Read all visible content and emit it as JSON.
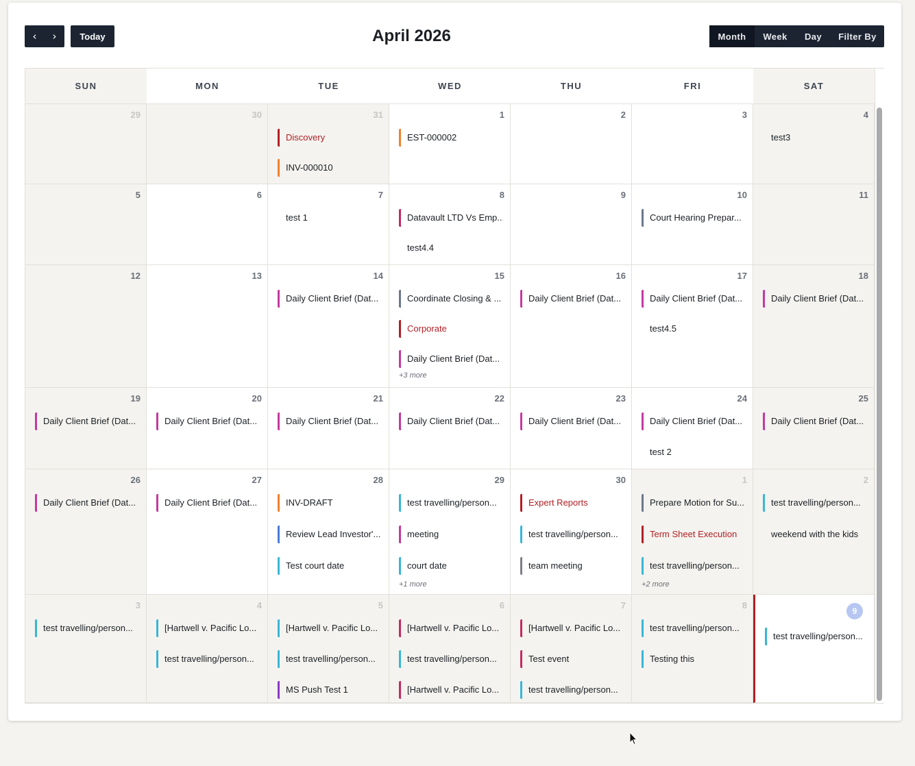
{
  "toolbar": {
    "prev_icon": "‹",
    "next_icon": "›",
    "today_label": "Today",
    "title": "April 2026",
    "views": [
      "Month",
      "Week",
      "Day",
      "Filter By"
    ],
    "active_view": "Month"
  },
  "colors": {
    "red": "#b21f24",
    "orange": "#f0812e",
    "magenta": "#c3399f",
    "crimson": "#c42a61",
    "slate": "#6b778c",
    "cyan": "#38b6d6",
    "blue": "#4a7bd8",
    "purple": "#8d37c7",
    "gray": "#7d7f86"
  },
  "days_of_week": [
    "SUN",
    "MON",
    "TUE",
    "WED",
    "THU",
    "FRI",
    "SAT"
  ],
  "weeks": [
    [
      {
        "day": "29",
        "muted": true,
        "events": []
      },
      {
        "day": "30",
        "muted": true,
        "events": []
      },
      {
        "day": "31",
        "muted": true,
        "events": [
          {
            "title": "Discovery",
            "color": "red",
            "red_text": true
          },
          {
            "title": "INV-000010",
            "color": "orange"
          }
        ]
      },
      {
        "day": "1",
        "events": [
          {
            "title": "EST-000002",
            "color": "orange"
          }
        ]
      },
      {
        "day": "2",
        "events": []
      },
      {
        "day": "3",
        "events": []
      },
      {
        "day": "4",
        "weekend": true,
        "events": [
          {
            "title": "test3",
            "color": null
          }
        ]
      }
    ],
    [
      {
        "day": "5",
        "weekend": true,
        "events": []
      },
      {
        "day": "6",
        "events": []
      },
      {
        "day": "7",
        "events": [
          {
            "title": "test 1",
            "color": null
          }
        ]
      },
      {
        "day": "8",
        "events": [
          {
            "title": "Datavault LTD Vs Emp...",
            "color": "crimson"
          },
          {
            "title": "test4.4",
            "color": null
          }
        ]
      },
      {
        "day": "9",
        "events": []
      },
      {
        "day": "10",
        "events": [
          {
            "title": "Court Hearing Prepar...",
            "color": "slate"
          }
        ]
      },
      {
        "day": "11",
        "weekend": true,
        "events": []
      }
    ],
    [
      {
        "day": "12",
        "weekend": true,
        "events": []
      },
      {
        "day": "13",
        "events": []
      },
      {
        "day": "14",
        "events": [
          {
            "title": "Daily Client Brief (Dat...",
            "color": "magenta"
          }
        ]
      },
      {
        "day": "15",
        "events": [
          {
            "title": "Coordinate Closing & ...",
            "color": "slate"
          },
          {
            "title": "Corporate",
            "color": "red",
            "red_text": true
          },
          {
            "title": "Daily Client Brief (Dat...",
            "color": "magenta"
          }
        ],
        "more": "+3 more"
      },
      {
        "day": "16",
        "events": [
          {
            "title": "Daily Client Brief (Dat...",
            "color": "magenta"
          }
        ]
      },
      {
        "day": "17",
        "events": [
          {
            "title": "Daily Client Brief (Dat...",
            "color": "magenta"
          },
          {
            "title": "test4.5",
            "color": null
          }
        ]
      },
      {
        "day": "18",
        "weekend": true,
        "events": [
          {
            "title": "Daily Client Brief (Dat...",
            "color": "magenta"
          }
        ]
      }
    ],
    [
      {
        "day": "19",
        "weekend": true,
        "events": [
          {
            "title": "Daily Client Brief (Dat...",
            "color": "magenta"
          }
        ]
      },
      {
        "day": "20",
        "events": [
          {
            "title": "Daily Client Brief (Dat...",
            "color": "magenta"
          }
        ]
      },
      {
        "day": "21",
        "events": [
          {
            "title": "Daily Client Brief (Dat...",
            "color": "magenta"
          }
        ]
      },
      {
        "day": "22",
        "events": [
          {
            "title": "Daily Client Brief (Dat...",
            "color": "magenta"
          }
        ]
      },
      {
        "day": "23",
        "events": [
          {
            "title": "Daily Client Brief (Dat...",
            "color": "magenta"
          }
        ]
      },
      {
        "day": "24",
        "events": [
          {
            "title": "Daily Client Brief (Dat...",
            "color": "magenta"
          },
          {
            "title": "test 2",
            "color": null
          }
        ]
      },
      {
        "day": "25",
        "weekend": true,
        "events": [
          {
            "title": "Daily Client Brief (Dat...",
            "color": "magenta"
          }
        ]
      }
    ],
    [
      {
        "day": "26",
        "weekend": true,
        "events": [
          {
            "title": "Daily Client Brief (Dat...",
            "color": "magenta"
          }
        ]
      },
      {
        "day": "27",
        "events": [
          {
            "title": "Daily Client Brief (Dat...",
            "color": "magenta"
          }
        ]
      },
      {
        "day": "28",
        "events": [
          {
            "title": "INV-DRAFT",
            "color": "orange"
          },
          {
            "title": "Review Lead Investor'...",
            "color": "blue"
          },
          {
            "title": "Test court date",
            "color": "cyan"
          }
        ]
      },
      {
        "day": "29",
        "events": [
          {
            "title": "test travelling/person...",
            "color": "cyan"
          },
          {
            "title": "meeting",
            "color": "magenta"
          },
          {
            "title": "court date",
            "color": "cyan"
          }
        ],
        "more": "+1 more"
      },
      {
        "day": "30",
        "events": [
          {
            "title": "Expert Reports",
            "color": "red",
            "red_text": true
          },
          {
            "title": "test travelling/person...",
            "color": "cyan"
          },
          {
            "title": "team meeting",
            "color": "gray"
          }
        ]
      },
      {
        "day": "1",
        "muted": true,
        "events": [
          {
            "title": "Prepare Motion for Su...",
            "color": "slate"
          },
          {
            "title": "Term Sheet Execution",
            "color": "red",
            "red_text": true
          },
          {
            "title": "test travelling/person...",
            "color": "cyan"
          }
        ],
        "more": "+2 more"
      },
      {
        "day": "2",
        "muted": true,
        "events": [
          {
            "title": "test travelling/person...",
            "color": "cyan"
          },
          {
            "title": "weekend with the kids",
            "color": null
          }
        ]
      }
    ],
    [
      {
        "day": "3",
        "muted": true,
        "events": [
          {
            "title": "test travelling/person...",
            "color": "cyan"
          }
        ]
      },
      {
        "day": "4",
        "muted": true,
        "events": [
          {
            "title": "[Hartwell v. Pacific Lo...",
            "color": "cyan"
          },
          {
            "title": "test travelling/person...",
            "color": "cyan"
          }
        ]
      },
      {
        "day": "5",
        "muted": true,
        "events": [
          {
            "title": "[Hartwell v. Pacific Lo...",
            "color": "cyan"
          },
          {
            "title": "test travelling/person...",
            "color": "cyan"
          },
          {
            "title": "MS Push Test 1",
            "color": "purple"
          }
        ]
      },
      {
        "day": "6",
        "muted": true,
        "events": [
          {
            "title": "[Hartwell v. Pacific Lo...",
            "color": "crimson"
          },
          {
            "title": "test travelling/person...",
            "color": "cyan"
          },
          {
            "title": "[Hartwell v. Pacific Lo...",
            "color": "crimson"
          }
        ]
      },
      {
        "day": "7",
        "muted": true,
        "events": [
          {
            "title": "[Hartwell v. Pacific Lo...",
            "color": "crimson"
          },
          {
            "title": "Test event",
            "color": "crimson"
          },
          {
            "title": "test travelling/person...",
            "color": "cyan"
          }
        ]
      },
      {
        "day": "8",
        "muted": true,
        "events": [
          {
            "title": "test travelling/person...",
            "color": "cyan"
          },
          {
            "title": "Testing this",
            "color": "cyan"
          }
        ]
      },
      {
        "day": "9",
        "today": true,
        "events": [
          {
            "title": "test travelling/person...",
            "color": "cyan"
          }
        ]
      }
    ]
  ]
}
